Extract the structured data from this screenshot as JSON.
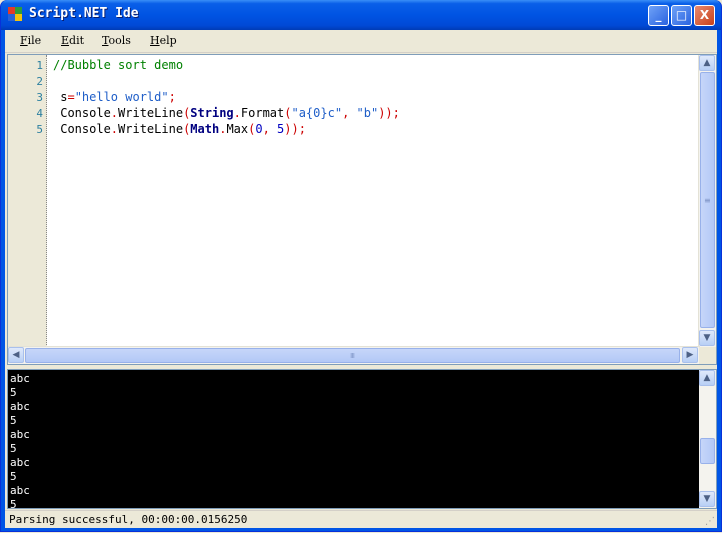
{
  "window": {
    "title": "Script.NET Ide",
    "minimize_label": "_",
    "maximize_label": "□",
    "close_label": "X"
  },
  "menu": [
    {
      "mnemonic": "F",
      "rest": "ile"
    },
    {
      "mnemonic": "E",
      "rest": "dit"
    },
    {
      "mnemonic": "T",
      "rest": "ools"
    },
    {
      "mnemonic": "H",
      "rest": "elp"
    }
  ],
  "editor": {
    "line_numbers": [
      "1",
      "2",
      "3",
      "4",
      "5"
    ],
    "lines": [
      [
        {
          "t": "//Bubble sort demo",
          "c": "cmt"
        }
      ],
      [],
      [
        {
          "t": " s",
          "c": ""
        },
        {
          "t": "=",
          "c": "pun"
        },
        {
          "t": "\"hello world\"",
          "c": "str"
        },
        {
          "t": ";",
          "c": "pun"
        }
      ],
      [
        {
          "t": " Console",
          "c": ""
        },
        {
          "t": ".",
          "c": "pun"
        },
        {
          "t": "WriteLine",
          "c": ""
        },
        {
          "t": "(",
          "c": "pun"
        },
        {
          "t": "String",
          "c": "kw"
        },
        {
          "t": ".",
          "c": "pun"
        },
        {
          "t": "Format",
          "c": ""
        },
        {
          "t": "(",
          "c": "pun"
        },
        {
          "t": "\"a{0}c\"",
          "c": "str"
        },
        {
          "t": ", ",
          "c": "pun"
        },
        {
          "t": "\"b\"",
          "c": "str"
        },
        {
          "t": "));",
          "c": "pun"
        }
      ],
      [
        {
          "t": " Console",
          "c": ""
        },
        {
          "t": ".",
          "c": "pun"
        },
        {
          "t": "WriteLine",
          "c": ""
        },
        {
          "t": "(",
          "c": "pun"
        },
        {
          "t": "Math",
          "c": "kw"
        },
        {
          "t": ".",
          "c": "pun"
        },
        {
          "t": "Max",
          "c": ""
        },
        {
          "t": "(",
          "c": "pun"
        },
        {
          "t": "0",
          "c": "num"
        },
        {
          "t": ", ",
          "c": "pun"
        },
        {
          "t": "5",
          "c": "num"
        },
        {
          "t": "));",
          "c": "pun"
        }
      ]
    ]
  },
  "console": {
    "lines": [
      "abc",
      "5",
      "abc",
      "5",
      "abc",
      "5",
      "abc",
      "5",
      "abc",
      "5"
    ]
  },
  "status": {
    "text": "Parsing successful, 00:00:00.0156250"
  },
  "colors": {
    "titlebar": "#0054e3",
    "console_bg": "#000000",
    "comment": "#008000",
    "string": "#1f5ec8",
    "keyword": "#000080"
  }
}
